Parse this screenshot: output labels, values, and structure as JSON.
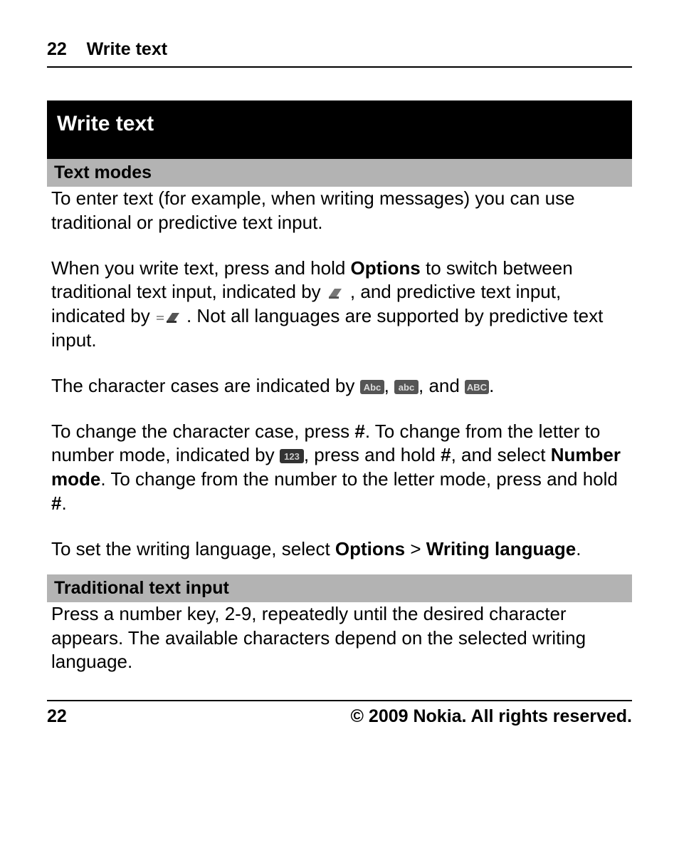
{
  "header": {
    "page_number": "22",
    "section_name": "Write text"
  },
  "chapter_title": "Write text",
  "sections": {
    "text_modes": {
      "heading": "Text modes",
      "p1": "To enter text (for example, when writing messages) you can use traditional or predictive text input.",
      "p2a": "When you write text, press and hold ",
      "p2_options": "Options",
      "p2b": " to switch between traditional text input, indicated by ",
      "p2c": ", and predictive text input, indicated by ",
      "p2d": ". Not all languages are supported by predictive text input.",
      "p3a": "The character cases are indicated by ",
      "p3b": ", ",
      "p3c": ", and ",
      "p3d": ".",
      "p4a": "To change the character case, press ",
      "p4_hash1": "#",
      "p4b": ". To change from the letter to number mode, indicated by ",
      "p4c": ", press and hold ",
      "p4_hash2": "#",
      "p4d": ", and select ",
      "p4_number_mode": "Number mode",
      "p4e": ". To change from the number to the letter mode, press and hold ",
      "p4_hash3": "#",
      "p4f": ".",
      "p5a": "To set the writing language, select ",
      "p5_options": "Options",
      "p5_sep": " > ",
      "p5_writing_language": "Writing language",
      "p5b": "."
    },
    "traditional": {
      "heading": "Traditional text input",
      "p1": "Press a number key, 2-9, repeatedly until the desired character appears. The available characters depend on the selected writing language."
    }
  },
  "footer": {
    "page_number": "22",
    "copyright": "© 2009 Nokia. All rights reserved."
  },
  "icons": {
    "pencil_traditional": "traditional-input-icon",
    "pencil_predictive": "predictive-input-icon",
    "case_sentence": "Abc",
    "case_lower": "abc",
    "case_upper": "ABC",
    "num_mode": "123"
  }
}
